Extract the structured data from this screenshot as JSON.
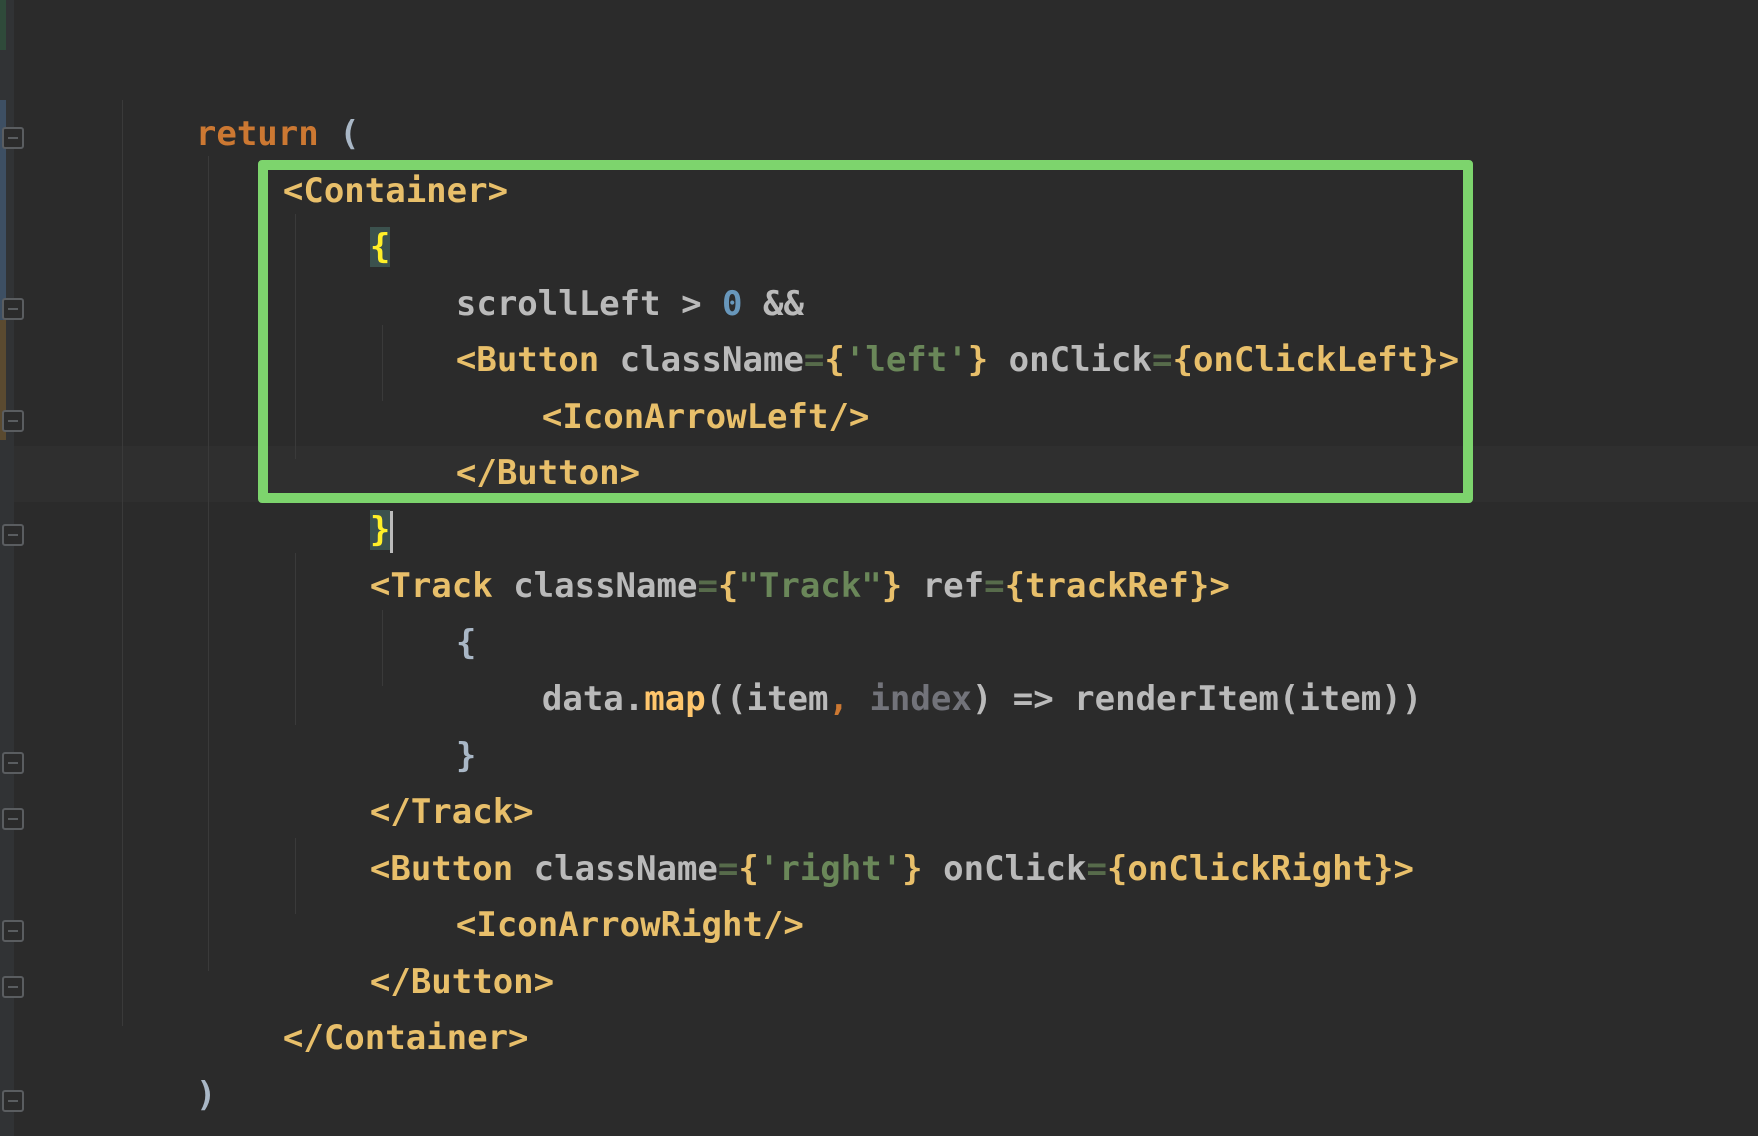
{
  "code": {
    "return_kw": "return",
    "open_paren": " (",
    "container_open": "<Container>",
    "expr_open_brace": "{",
    "scroll_left": "scrollLeft",
    "gt_op": " > ",
    "zero": "0",
    "and_op": " &&",
    "button_left_open_tag": "<Button",
    "class_name_attr": "className",
    "eq": "=",
    "lbrace": "{",
    "rbrace": "}",
    "left_str": "'left'",
    "on_click_attr": "onClick",
    "on_click_left": "onClickLeft",
    "tag_close": ">",
    "icon_arrow_left": "<IconArrowLeft/>",
    "button_close": "</Button>",
    "expr_close_brace": "}",
    "track_open_tag": "<Track",
    "track_str": "\"Track\"",
    "ref_attr": "ref",
    "track_ref": "trackRef",
    "map_open_brace": "{",
    "data_ident": "data.",
    "map_fn": "map",
    "map_args_open": "((item",
    "comma": ", ",
    "index_param": "index",
    "arrow_part": ") => ",
    "render_item": "renderItem(item))",
    "map_close_brace": "}",
    "track_close": "</Track>",
    "right_str": "'right'",
    "on_click_right": "onClickRight",
    "icon_arrow_right": "<IconArrowRight/>",
    "container_close": "</Container>",
    "close_paren": ")",
    "function_close": "}"
  },
  "colors": {
    "background": "#2b2b2b",
    "keyword": "#cc7832",
    "tag": "#e8bf6a",
    "string": "#6a8759",
    "number": "#6897bb",
    "function": "#ffc66d",
    "highlight_box": "#7dd46d"
  }
}
